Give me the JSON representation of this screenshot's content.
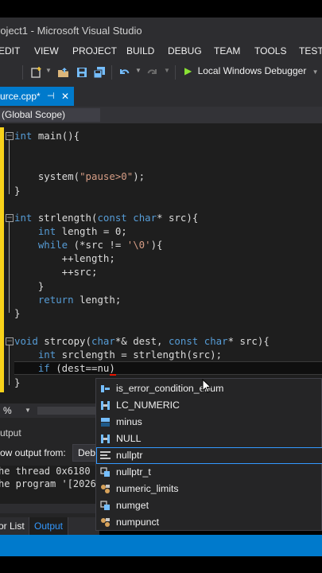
{
  "window": {
    "title": "roject1 - Microsoft Visual Studio"
  },
  "menu": {
    "items": [
      "EDIT",
      "VIEW",
      "PROJECT",
      "BUILD",
      "DEBUG",
      "TEAM",
      "TOOLS",
      "TEST"
    ]
  },
  "toolbar": {
    "debugger_label": "Local Windows Debugger"
  },
  "tab": {
    "label": "urce.cpp*",
    "pin": "⊣",
    "close": "✕"
  },
  "nav": {
    "scope": "(Global Scope)"
  },
  "code": {
    "l1_kw": "int",
    "l1_rest": " main(){",
    "l4_fn": "    system(",
    "l4_str": "\"pause>0\"",
    "l4_end": ");",
    "l5": "}",
    "l7_kw": "int",
    "l7_a": " strlength(",
    "l7_kw2": "const",
    "l7_sp": " ",
    "l7_kw3": "char",
    "l7_b": "* src){",
    "l8_kw": "    int",
    "l8_rest": " length = 0;",
    "l9_kw": "    while",
    "l9_a": " (*src != ",
    "l9_str": "'\\0'",
    "l9_b": "){",
    "l10": "        ++length;",
    "l11": "        ++src;",
    "l12": "    }",
    "l13_kw": "    return",
    "l13_rest": " length;",
    "l14": "}",
    "l16_kw": "void",
    "l16_a": " strcopy(",
    "l16_kw2": "char",
    "l16_b": "*& dest, ",
    "l16_kw3": "const",
    "l16_sp": " ",
    "l16_kw4": "char",
    "l16_c": "* src){",
    "l17_kw": "    int",
    "l17_rest": " srclength = strlength(src);",
    "l18_kw": "    if",
    "l18_rest": " (dest==nu)",
    "l19": "}"
  },
  "zoom": {
    "value": "%"
  },
  "output": {
    "title": "utput",
    "show_from": "ow output from:",
    "source": "Debu",
    "lines": [
      "he thread 0x6180 ha",
      "he program '[20264"
    ]
  },
  "bottom_tabs": {
    "error_list": "or List",
    "output": "Output"
  },
  "completion": {
    "items": [
      {
        "label": "is_error_condition_enum",
        "icon": "enum-icon"
      },
      {
        "label": "LC_NUMERIC",
        "icon": "macro-icon"
      },
      {
        "label": "minus",
        "icon": "class-icon"
      },
      {
        "label": "NULL",
        "icon": "macro-icon"
      },
      {
        "label": "nullptr",
        "icon": "keyword-icon"
      },
      {
        "label": "nullptr_t",
        "icon": "typedef-icon"
      },
      {
        "label": "numeric_limits",
        "icon": "template-icon"
      },
      {
        "label": "numget",
        "icon": "typedef-icon"
      },
      {
        "label": "numpunct",
        "icon": "template-icon"
      }
    ],
    "selected_index": 4
  },
  "colors": {
    "accent": "#007acc",
    "gutter": "#f8d21a",
    "keyword": "#569cd6",
    "string": "#d69d85"
  }
}
